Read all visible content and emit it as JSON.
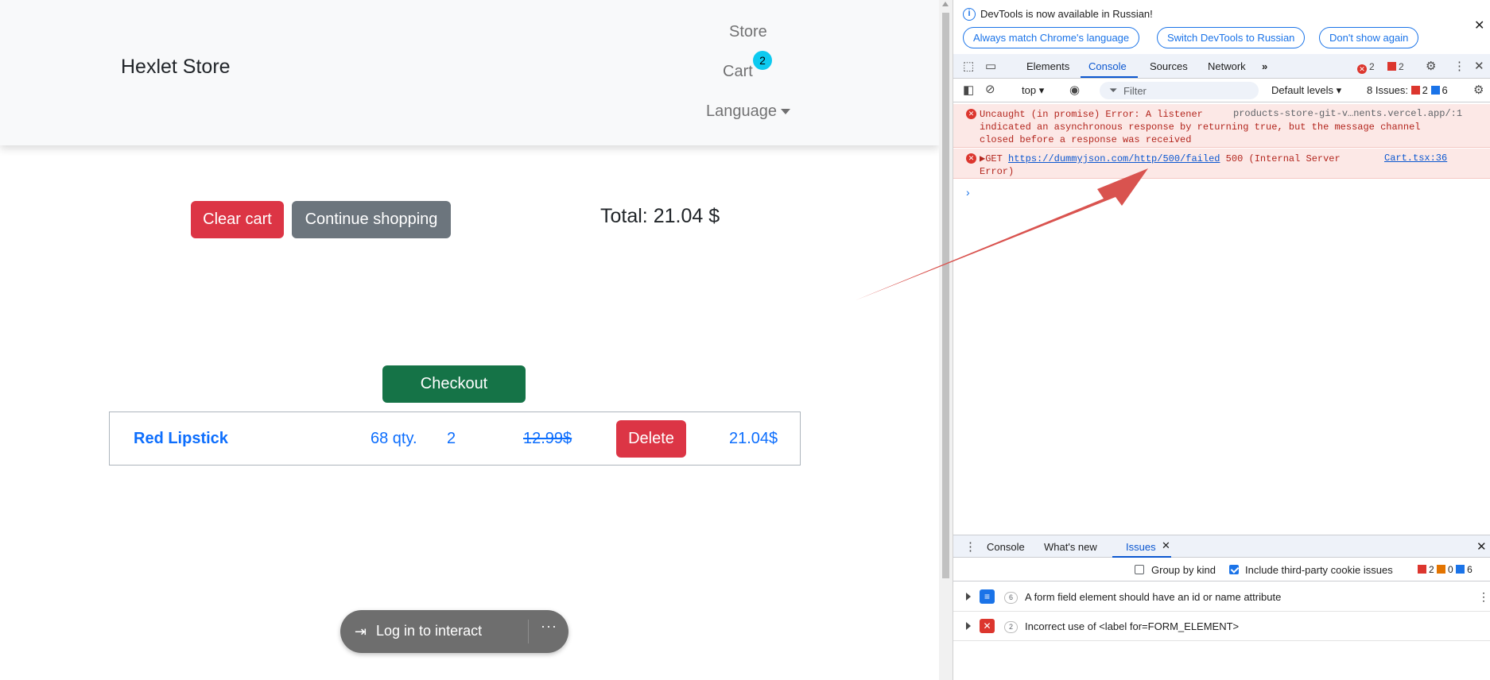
{
  "page": {
    "brand": "Hexlet Store",
    "nav": {
      "store": "Store",
      "cart": "Cart",
      "cart_count": "2",
      "language": "Language"
    },
    "buttons": {
      "clear_cart": "Clear cart",
      "continue_shopping": "Continue shopping",
      "checkout": "Checkout",
      "delete": "Delete"
    },
    "total": "Total: 21.04 $",
    "cart_item": {
      "name": "Red Lipstick",
      "stock": "68 qty.",
      "quantity": "2",
      "old_price": "12.99$",
      "sum": "21.04$"
    },
    "login_overlay": {
      "text": "Log in to interact",
      "more": "···"
    }
  },
  "devtools": {
    "infobar": {
      "message": "DevTools is now available in Russian!",
      "buttons": [
        "Always match Chrome's language",
        "Switch DevTools to Russian",
        "Don't show again"
      ]
    },
    "tabs": [
      "Elements",
      "Console",
      "Sources",
      "Network"
    ],
    "active_tab": "Console",
    "error_badge": {
      "errors": "2",
      "warnings": "2"
    },
    "toolbar": {
      "context": "top",
      "filter_placeholder": "Filter",
      "levels": "Default levels",
      "issues": "8 Issues:",
      "issues_red": "2",
      "issues_blue": "6"
    },
    "messages": [
      {
        "text": "Uncaught (in promise) Error: A listener\nindicated an asynchronous response by returning true, but the message channel\nclosed before a response was received",
        "source": "products-store-git-v…nents.vercel.app/:1"
      },
      {
        "prefix": "▶GET ",
        "url": "https://dummyjson.com/http/500/failed",
        "suffix": " 500 (Internal Server\nError)",
        "source": "Cart.tsx:36"
      }
    ],
    "drawer": {
      "tabs": [
        "Console",
        "What's new",
        "Issues"
      ],
      "active_tab": "Issues",
      "group_by_kind": "Group by kind",
      "include_third_party": "Include third-party cookie issues",
      "counters": {
        "red": "2",
        "orange": "0",
        "blue": "6"
      },
      "issues": [
        {
          "count": "6",
          "text": "A form field element should have an id or name attribute",
          "color": "#1a73e8"
        },
        {
          "count": "2",
          "text": "Incorrect use of <label for=FORM_ELEMENT>",
          "color": "#dc362e"
        }
      ]
    }
  },
  "colors": {
    "danger": "#dc3545",
    "secondary": "#6c757d",
    "success": "#157347",
    "link": "#0d6efd",
    "info": "#0dcaf0",
    "arrow": "#d9534f"
  }
}
